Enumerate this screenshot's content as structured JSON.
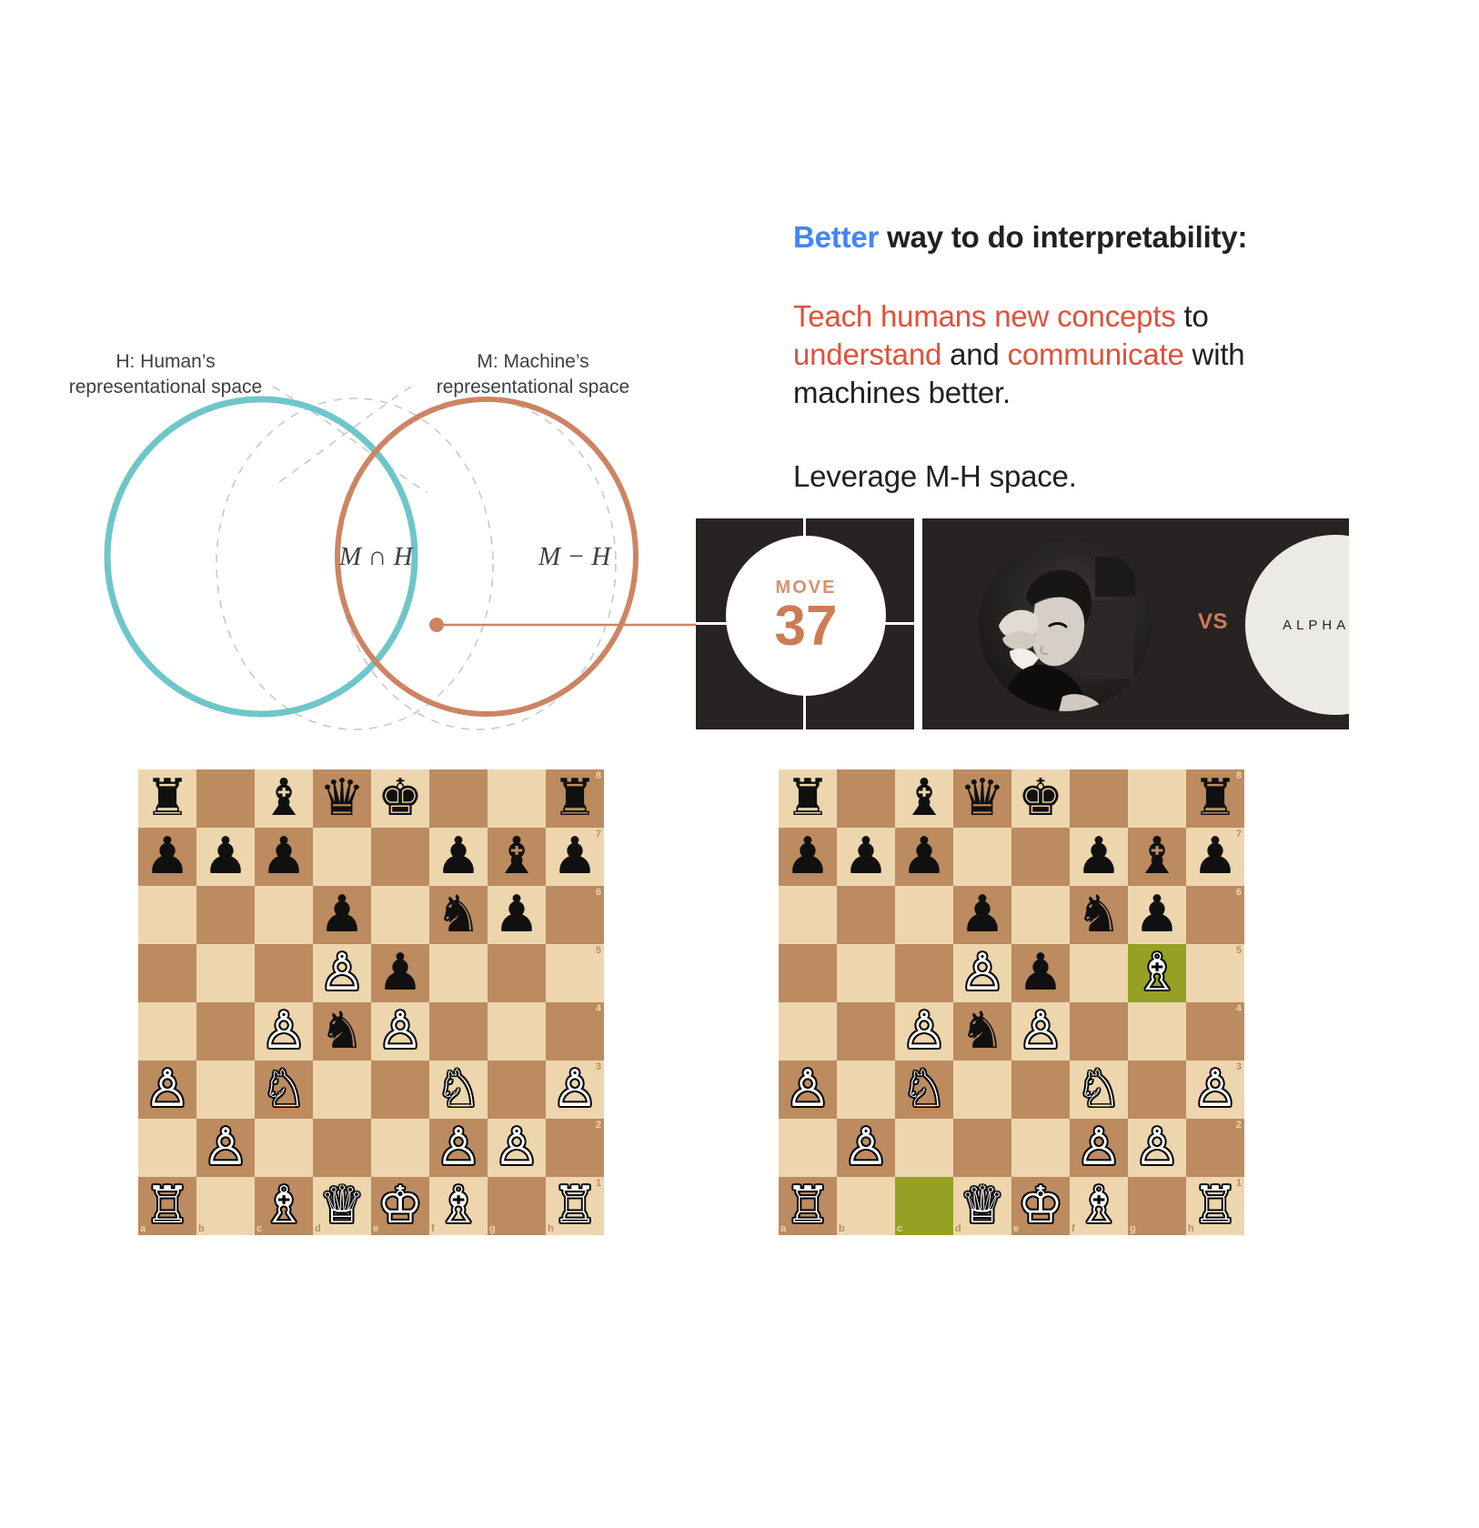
{
  "slide": {
    "headline": {
      "emphasis": "Better",
      "rest": " way to do interpretability:"
    },
    "body": {
      "seg1": "Teach humans new concepts",
      "seg2": " to ",
      "seg3": "understand",
      "seg4": " and ",
      "seg5": "communicate",
      "seg6": " with machines better."
    },
    "subline": "Leverage M-H space."
  },
  "venn": {
    "human_label": "H: Human’s\nrepresentational space",
    "human_label_line1": "H: Human’s",
    "human_label_line2": "representational space",
    "machine_label_line1": "M: Machine’s",
    "machine_label_line2": "representational space",
    "intersection_label": "M ∩ H",
    "difference_label": "M − H",
    "human_color": "#6ec6c9",
    "machine_color": "#cd8463",
    "ghost_color": "#c9c9c9"
  },
  "move_panel": {
    "move_word": "MOVE",
    "move_number": "37",
    "accent_color": "#cd7b55",
    "background_color": "#262322"
  },
  "match_panel": {
    "vs_label": "VS",
    "alphago_label": "ALPHA GO",
    "player_photo_alt": "lee-sedol-photo"
  },
  "boards": [
    {
      "id": "board-left",
      "files": [
        "a",
        "b",
        "c",
        "d",
        "e",
        "f",
        "g",
        "h"
      ],
      "ranks": [
        "8",
        "7",
        "6",
        "5",
        "4",
        "3",
        "2",
        "1"
      ],
      "highlights": [],
      "position": [
        [
          "r",
          "",
          "b",
          "q",
          "k",
          "",
          "",
          "r"
        ],
        [
          "p",
          "p",
          "p",
          "",
          "",
          "p",
          "b",
          "p"
        ],
        [
          "",
          "",
          "",
          "p",
          "",
          "n",
          "p",
          ""
        ],
        [
          "",
          "",
          "",
          "P",
          "p",
          "",
          "",
          ""
        ],
        [
          "",
          "",
          "P",
          "n",
          "P",
          "",
          "",
          ""
        ],
        [
          "P",
          "",
          "N",
          "",
          "",
          "N",
          "",
          "P"
        ],
        [
          "",
          "P",
          "",
          "",
          "",
          "P",
          "P",
          ""
        ],
        [
          "R",
          "",
          "B",
          "Q",
          "K",
          "B",
          "",
          "R"
        ]
      ]
    },
    {
      "id": "board-right",
      "files": [
        "a",
        "b",
        "c",
        "d",
        "e",
        "f",
        "g",
        "h"
      ],
      "ranks": [
        "8",
        "7",
        "6",
        "5",
        "4",
        "3",
        "2",
        "1"
      ],
      "highlights": [
        "g5",
        "c1"
      ],
      "position": [
        [
          "r",
          "",
          "b",
          "q",
          "k",
          "",
          "",
          "r"
        ],
        [
          "p",
          "p",
          "p",
          "",
          "",
          "p",
          "b",
          "p"
        ],
        [
          "",
          "",
          "",
          "p",
          "",
          "n",
          "p",
          ""
        ],
        [
          "",
          "",
          "",
          "P",
          "p",
          "",
          "B",
          ""
        ],
        [
          "",
          "",
          "P",
          "n",
          "P",
          "",
          "",
          ""
        ],
        [
          "P",
          "",
          "N",
          "",
          "",
          "N",
          "",
          "P"
        ],
        [
          "",
          "P",
          "",
          "",
          "",
          "P",
          "P",
          ""
        ],
        [
          "R",
          "",
          "",
          "Q",
          "K",
          "B",
          "",
          "R"
        ]
      ],
      "highlight_color": "#96a023"
    }
  ],
  "board_colors": {
    "light": "#edd6ad",
    "dark": "#bc8b60"
  },
  "glyphs": {
    "K": "♔",
    "Q": "♕",
    "R": "♖",
    "B": "♗",
    "N": "♘",
    "P": "♙",
    "k": "♚",
    "q": "♛",
    "r": "♜",
    "b": "♝",
    "n": "♞",
    "p": "♟"
  }
}
